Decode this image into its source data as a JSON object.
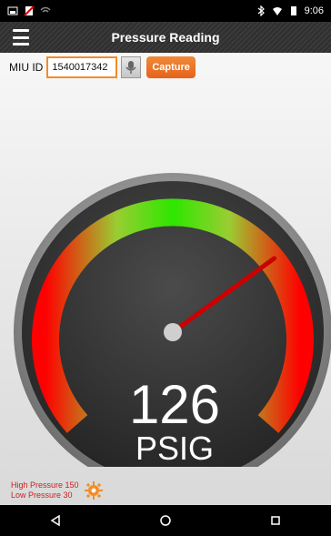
{
  "status_bar": {
    "time": "9:06"
  },
  "app_bar": {
    "title": "Pressure Reading"
  },
  "toolbar": {
    "miu_label": "MIU ID",
    "miu_value": "1540017342",
    "capture_label": "Capture"
  },
  "gauge": {
    "value": "126",
    "unit": "PSIG",
    "reading": 126,
    "scale_min": 0,
    "scale_max": 180,
    "colors": {
      "low": "#ff0000",
      "mid": "#7bd600",
      "high": "#ff0000",
      "needle": "#cc0000"
    }
  },
  "limits": {
    "high": "High Pressure 150",
    "low": "Low Pressure 30"
  },
  "icons": {
    "menu": "menu-icon",
    "mic": "microphone-icon",
    "settings": "gear-icon",
    "back": "back-icon",
    "home": "home-icon",
    "recents": "recents-icon"
  }
}
